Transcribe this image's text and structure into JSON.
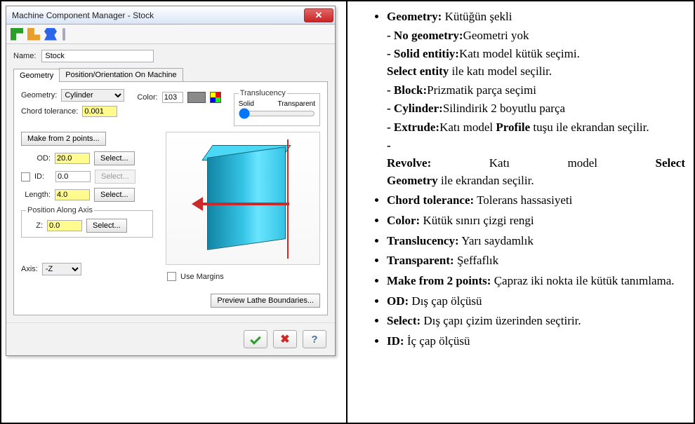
{
  "win": {
    "title": "Machine Component Manager - Stock",
    "close_glyph": "✕",
    "name_label": "Name:",
    "name_value": "Stock",
    "tabs": {
      "geometry": "Geometry",
      "pos": "Position/Orientation On Machine"
    },
    "geom_label": "Geometry:",
    "geom_value": "Cylinder",
    "chord_label": "Chord tolerance:",
    "chord_value": "0.001",
    "color_label": "Color:",
    "color_value": "103",
    "trans_legend": "Translucency",
    "trans_solid": "Solid",
    "trans_transparent": "Transparent",
    "make2pts": "Make from 2 points...",
    "od_label": "OD:",
    "od_value": "20.0",
    "id_label": "ID:",
    "id_value": "0.0",
    "len_label": "Length:",
    "len_value": "4.0",
    "pos_legend": "Position Along Axis",
    "z_label": "Z:",
    "z_value": "0.0",
    "select": "Select...",
    "axis_label": "Axis:",
    "axis_value": "-Z",
    "use_margins": "Use Margins",
    "preview_btn": "Preview Lathe Boundaries..."
  },
  "desc": {
    "geometry": {
      "term": "Geometry:",
      "text": " Kütüğün şekli"
    },
    "no_geometry": {
      "term": "No geometry:",
      "text": "Geometri yok"
    },
    "solid_entity": {
      "term": "Solid entitiy:",
      "text": "Katı model kütük seçimi."
    },
    "solid_entity2": {
      "pre": "Select entity",
      "post": " ile katı model seçilir."
    },
    "block": {
      "term": "Block:",
      "text": "Prizmatik parça seçimi"
    },
    "cylinder": {
      "term": "Cylinder:",
      "text": "Silindirik 2 boyutlu parça"
    },
    "extrude": {
      "pre": "Extrude:",
      "mid1": "Katı model ",
      "mid2": "Profile",
      "post": " tuşu ile ekrandan seçilir."
    },
    "revolve": {
      "pre": "Revolve:",
      "mid1": "Katı",
      "mid2": "model",
      "mid3": "Select",
      "line2a": "Geometry",
      "line2b": " ile ekrandan  seçilir."
    },
    "chord": {
      "term": "Chord tolerance:",
      "text": " Tolerans hassasiyeti"
    },
    "color": {
      "term": "Color:",
      "text": " Kütük sınırı çizgi rengi"
    },
    "translucency": {
      "term": "Translucency:",
      "text": " Yarı saydamlık"
    },
    "transparent": {
      "term": "Transparent:",
      "text": " Şeffaflık"
    },
    "make2": {
      "term": "Make from 2 points:",
      "text": " Çapraz iki nokta ile kütük tanımlama."
    },
    "od": {
      "term": "OD:",
      "text": " Dış çap ölçüsü"
    },
    "select": {
      "term": "Select:",
      "text": " Dış çapı çizim üzerinden seçtirir."
    },
    "id": {
      "term": "ID:",
      "text": " İç çap ölçüsü"
    }
  }
}
